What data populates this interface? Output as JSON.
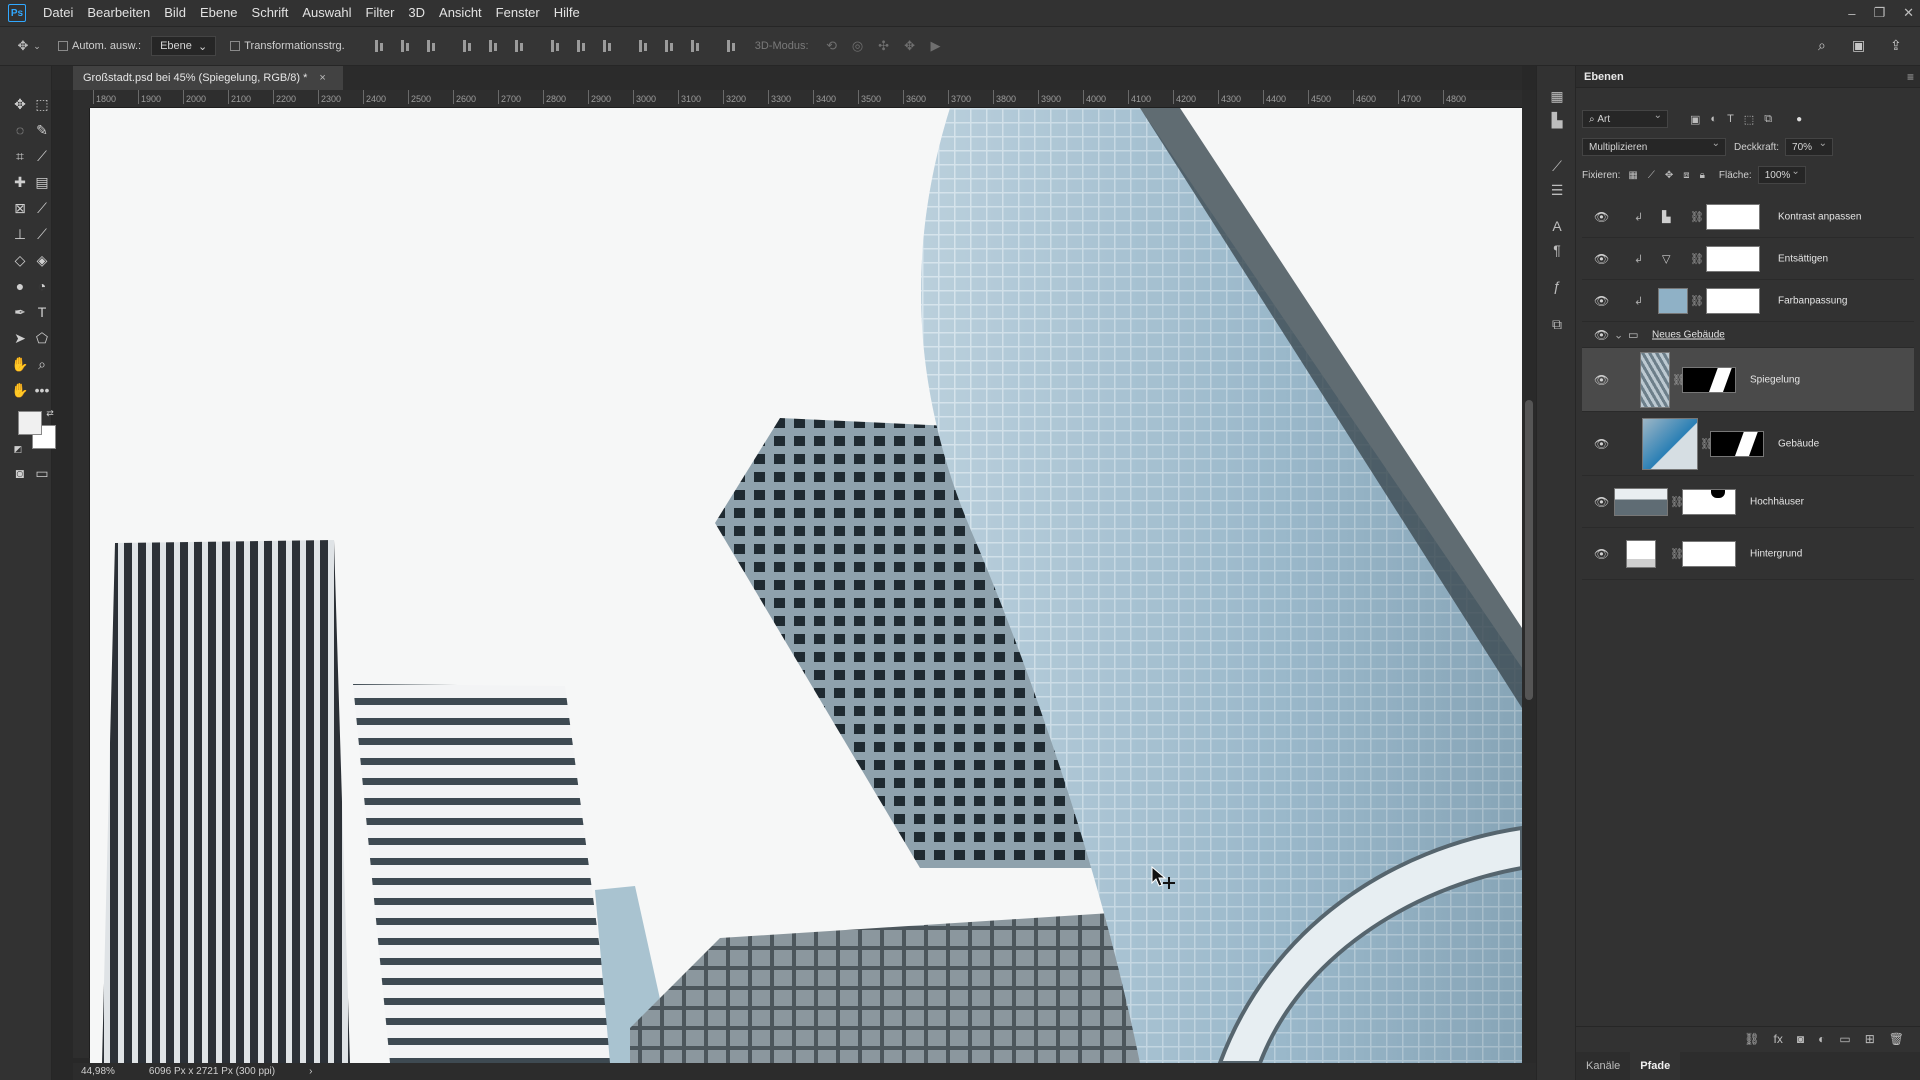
{
  "app": {
    "logo": "Ps"
  },
  "menu": [
    "Datei",
    "Bearbeiten",
    "Bild",
    "Ebene",
    "Schrift",
    "Auswahl",
    "Filter",
    "3D",
    "Ansicht",
    "Fenster",
    "Hilfe"
  ],
  "window_controls": [
    "–",
    "❐",
    "✕"
  ],
  "options": {
    "auto_select_label": "Autom. ausw.:",
    "auto_select_value": "Ebene",
    "transform_label": "Transformationsstrg.",
    "mode_3d_label": "3D-Modus:"
  },
  "document": {
    "tab_title": "Großstadt.psd bei 45% (Spiegelung, RGB/8) *",
    "close": "×",
    "zoom": "44,98%",
    "doc_info": "6096 Px x 2721 Px (300 ppi)"
  },
  "ruler_h": [
    "1800",
    "1900",
    "2000",
    "2100",
    "2200",
    "2300",
    "2400",
    "2500",
    "2600",
    "2700",
    "2800",
    "2900",
    "3000",
    "3100",
    "3200",
    "3300",
    "3400",
    "3500",
    "3600",
    "3700",
    "3800",
    "3900",
    "4000",
    "4100",
    "4200",
    "4300",
    "4400",
    "4500",
    "4600",
    "4700",
    "4800"
  ],
  "layers_panel": {
    "tab": "Ebenen",
    "filter_kind": "Art",
    "blend_mode": "Multiplizieren",
    "opacity_label": "Deckkraft:",
    "opacity_value": "70%",
    "lock_label": "Fixieren:",
    "fill_label": "Fläche:",
    "fill_value": "100%",
    "layers": [
      {
        "name": "Kontrast anpassen",
        "type": "adjustment",
        "icon": "levels-icon"
      },
      {
        "name": "Entsättigen",
        "type": "adjustment",
        "icon": "gradient-map-icon"
      },
      {
        "name": "Farbanpassung",
        "type": "adjustment",
        "icon": "color-fill-icon"
      },
      {
        "name": "Neues Gebäude",
        "type": "group"
      },
      {
        "name": "Spiegelung",
        "type": "smart",
        "selected": true
      },
      {
        "name": "Gebäude",
        "type": "smart"
      },
      {
        "name": "Hochhäuser",
        "type": "smart"
      },
      {
        "name": "Hintergrund",
        "type": "normal"
      }
    ]
  },
  "bottom_tabs": [
    "Kanäle",
    "Pfade"
  ],
  "colors": {
    "accent": "#31a8ff",
    "panel_bg": "#323232",
    "selected_layer": "#4a4a4a",
    "canvas_sky": "#f6f7f7"
  }
}
